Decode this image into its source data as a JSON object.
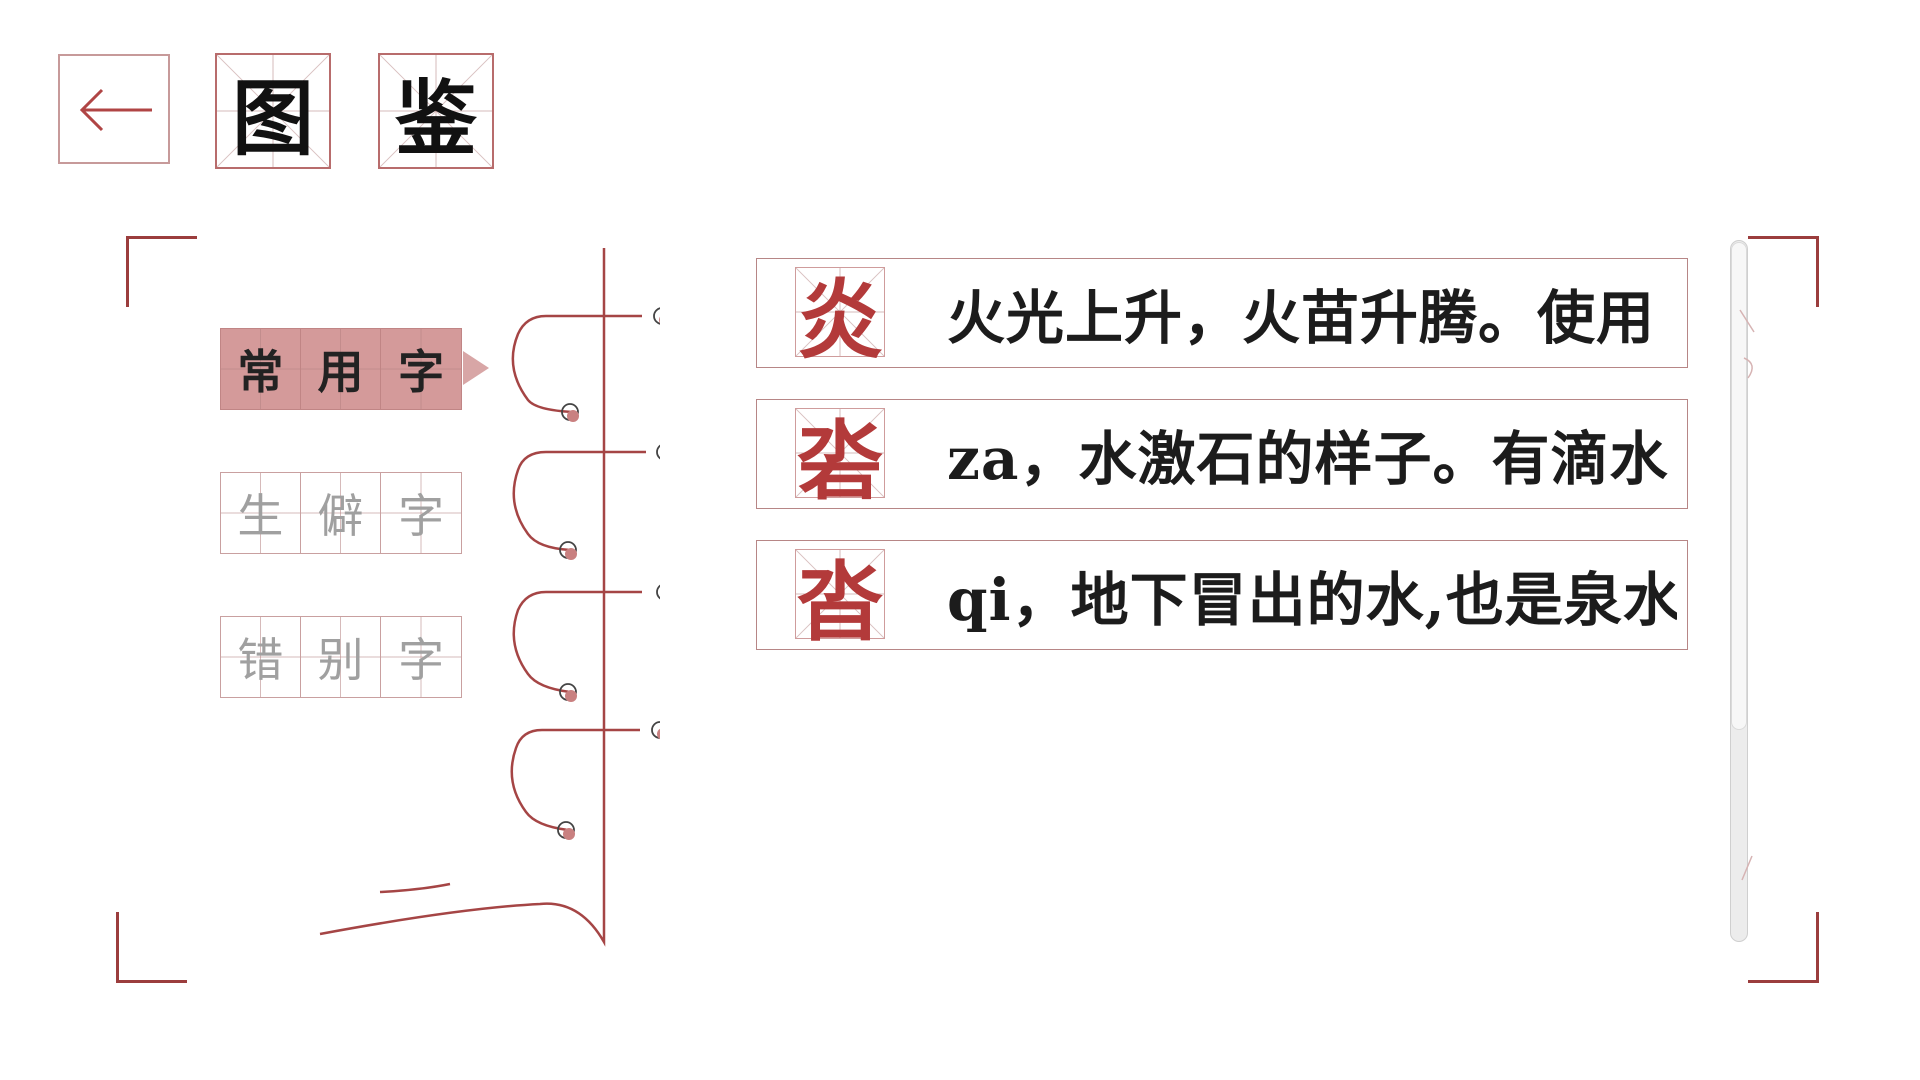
{
  "header": {
    "back_icon": "arrow-left-icon",
    "title_chars": [
      "图",
      "鉴"
    ]
  },
  "categories": [
    {
      "chars": [
        "常",
        "用",
        "字"
      ],
      "active": true
    },
    {
      "chars": [
        "生",
        "僻",
        "字"
      ],
      "active": false
    },
    {
      "chars": [
        "错",
        "别",
        "字"
      ],
      "active": false
    }
  ],
  "entries": [
    {
      "char": "炎",
      "description": "火光上升，火苗升腾。使用"
    },
    {
      "char": "沯",
      "description": "za，水激石的样子。有滴水"
    },
    {
      "char": "沓",
      "description": "qi，地下冒出的水,也是泉水"
    }
  ],
  "colors": {
    "accent": "#9b3d3d",
    "active_tab": "#d49a9a",
    "entry_char": "#b33a3a"
  }
}
